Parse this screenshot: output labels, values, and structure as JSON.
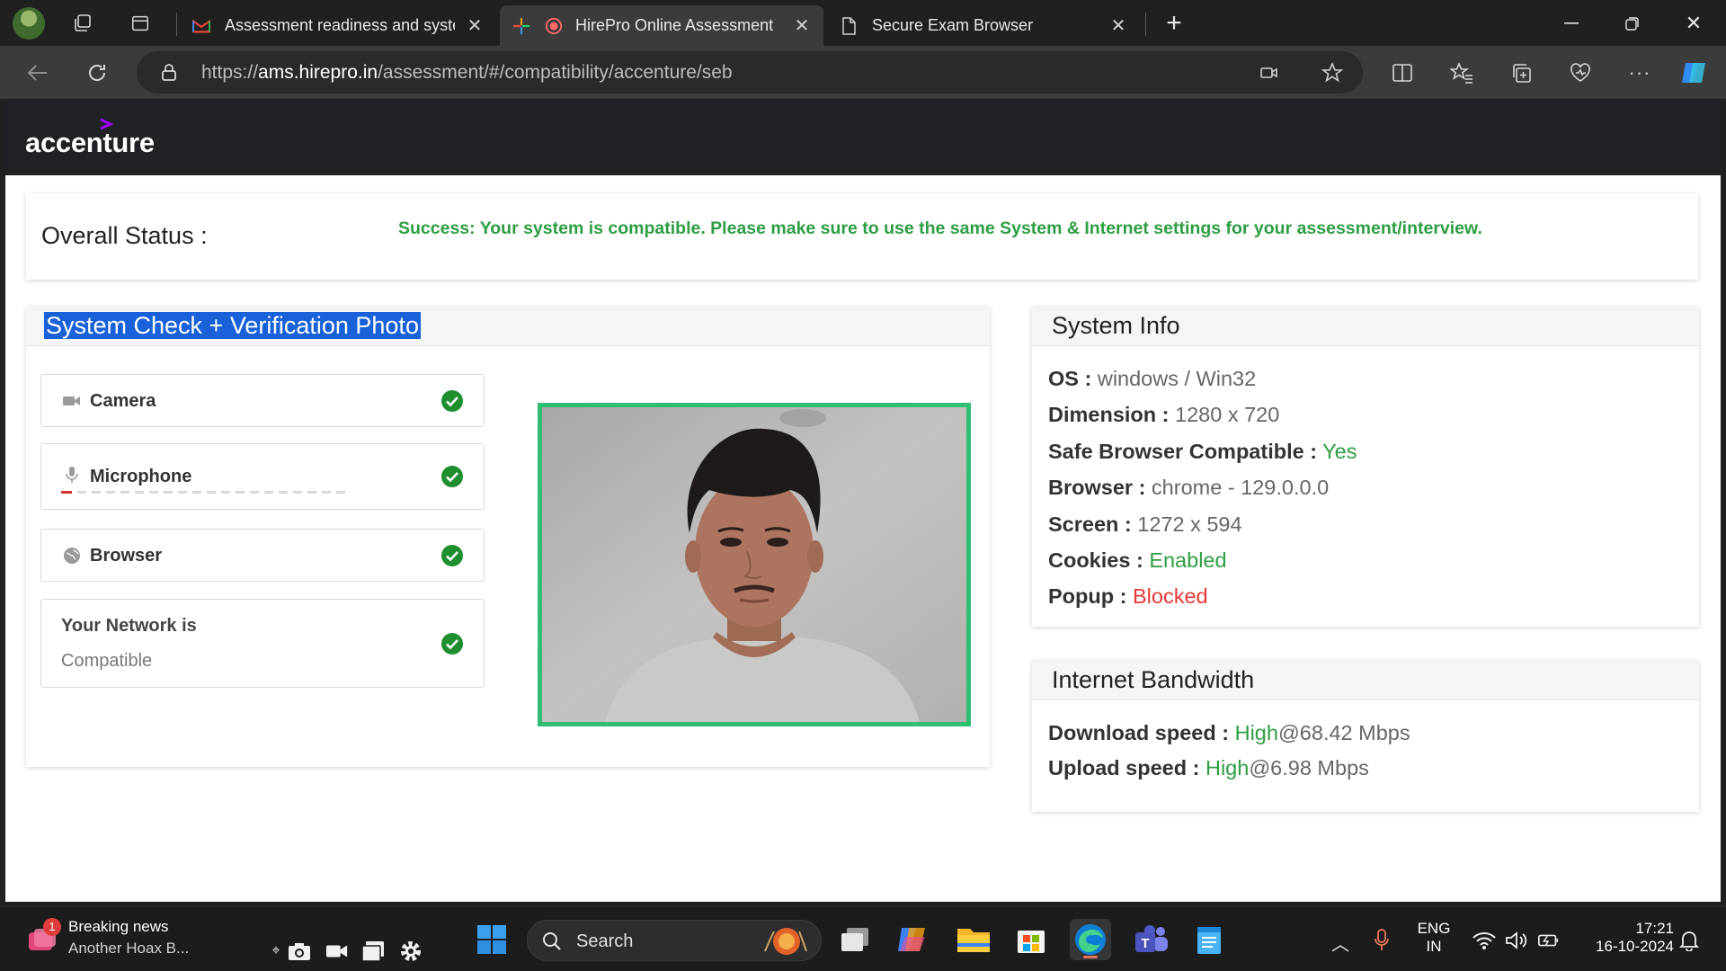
{
  "browser": {
    "tabs": [
      {
        "title": "Assessment readiness and system",
        "favicon": "gmail-icon"
      },
      {
        "title": "HirePro Online Assessment",
        "favicon": "hirepro-icon"
      },
      {
        "title": "Secure Exam Browser",
        "favicon": "page-icon"
      }
    ],
    "url_prefix": "https://",
    "url_host": "ams.hirepro.in",
    "url_path": "/assessment/#/compatibility/accenture/seb"
  },
  "brand": {
    "name": "accenture",
    "accent_color": "#a100ff"
  },
  "overall": {
    "label": "Overall Status :",
    "message": "Success: Your system is compatible. Please make sure to use the same System & Internet settings for your assessment/interview."
  },
  "system_check": {
    "title": "System Check + Verification Photo",
    "items": [
      {
        "label": "Camera",
        "icon": "camera-icon",
        "status": "ok"
      },
      {
        "label": "Microphone",
        "icon": "microphone-icon",
        "status": "ok"
      },
      {
        "label": "Browser",
        "icon": "globe-icon",
        "status": "ok"
      }
    ],
    "network_line1": "Your Network is",
    "network_line2": "Compatible"
  },
  "system_info": {
    "title": "System Info",
    "rows": [
      {
        "key": "OS :",
        "value": "windows / Win32"
      },
      {
        "key": "Dimension :",
        "value": "1280 x 720"
      },
      {
        "key": "Safe Browser Compatible :",
        "value": "Yes"
      },
      {
        "key": "Browser :",
        "value": "chrome - 129.0.0.0"
      },
      {
        "key": "Screen :",
        "value": "1272 x 594"
      },
      {
        "key": "Cookies :",
        "value": "Enabled"
      },
      {
        "key": "Popup :",
        "value": "Blocked"
      }
    ]
  },
  "bandwidth": {
    "title": "Internet Bandwidth",
    "download_key": "Download speed :",
    "download_level": "High",
    "download_value": "@68.42 Mbps",
    "upload_key": "Upload speed :",
    "upload_level": "High",
    "upload_value": "@6.98 Mbps"
  },
  "taskbar": {
    "news_badge": "1",
    "news_title": "Breaking news",
    "news_sub": "Another Hoax B...",
    "search_label": "Search",
    "lang1": "ENG",
    "lang2": "IN",
    "time": "17:21",
    "date": "16-10-2024"
  },
  "colors": {
    "success": "#2e9d43",
    "danger": "#e53935",
    "photo_border": "#2fbf74",
    "selection": "#1861d8"
  }
}
